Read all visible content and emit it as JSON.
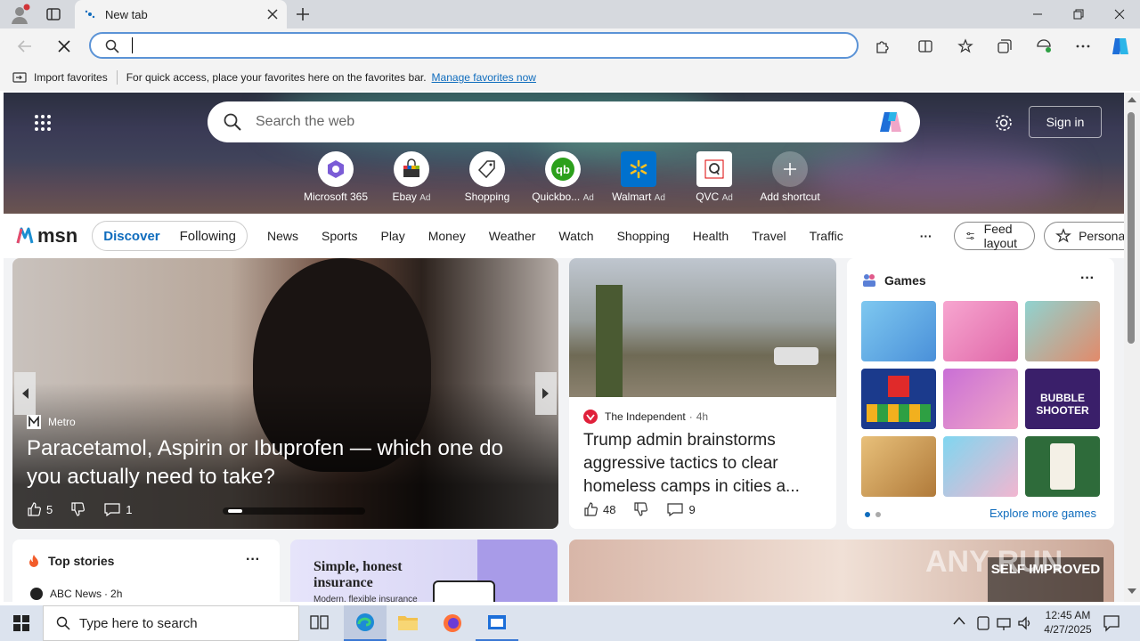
{
  "browser": {
    "tab_title": "New tab",
    "address_value": "",
    "favbar": {
      "import_label": "Import favorites",
      "message": "For quick access, place your favorites here on the favorites bar.",
      "manage_link": "Manage favorites now"
    }
  },
  "newtab": {
    "search_placeholder": "Search the web",
    "sign_in_label": "Sign in",
    "shortcuts": [
      {
        "label": "Microsoft 365",
        "ad": ""
      },
      {
        "label": "Ebay",
        "ad": "Ad"
      },
      {
        "label": "Shopping",
        "ad": ""
      },
      {
        "label": "Quickbo...",
        "ad": "Ad"
      },
      {
        "label": "Walmart",
        "ad": "Ad"
      },
      {
        "label": "QVC",
        "ad": "Ad"
      },
      {
        "label": "Add shortcut",
        "ad": ""
      }
    ],
    "msn_logo": "msn",
    "feed_tabs": {
      "discover": "Discover",
      "following": "Following"
    },
    "nav_links": [
      "News",
      "Sports",
      "Play",
      "Money",
      "Weather",
      "Watch",
      "Shopping",
      "Health",
      "Travel",
      "Traffic"
    ],
    "more_label": "···",
    "feed_layout_label": "Feed layout",
    "personalize_label": "Personalize"
  },
  "hero_story": {
    "source": "Metro",
    "headline": "Paracetamol, Aspirin or Ibuprofen — which one do you actually need to take?",
    "likes": "5",
    "comments": "1"
  },
  "second_story": {
    "source": "The Independent",
    "age": "4h",
    "headline": "Trump admin brainstorms aggressive tactics to clear homeless camps in cities a...",
    "likes": "48",
    "comments": "9"
  },
  "games": {
    "title": "Games",
    "explore_label": "Explore more games"
  },
  "top_stories": {
    "title": "Top stories",
    "first_source": "ABC News",
    "first_age": "2h"
  },
  "ad_card": {
    "headline": "Simple, honest insurance",
    "sub": "Modern, flexible insurance"
  },
  "watermark": "ANY RUN",
  "self_improved": "SELF IMPROVED",
  "taskbar": {
    "search_placeholder": "Type here to search",
    "time": "12:45 AM",
    "date": "4/27/2025"
  },
  "colors": {
    "accent": "#0f6cbd",
    "addr_border": "#5b93d6"
  }
}
